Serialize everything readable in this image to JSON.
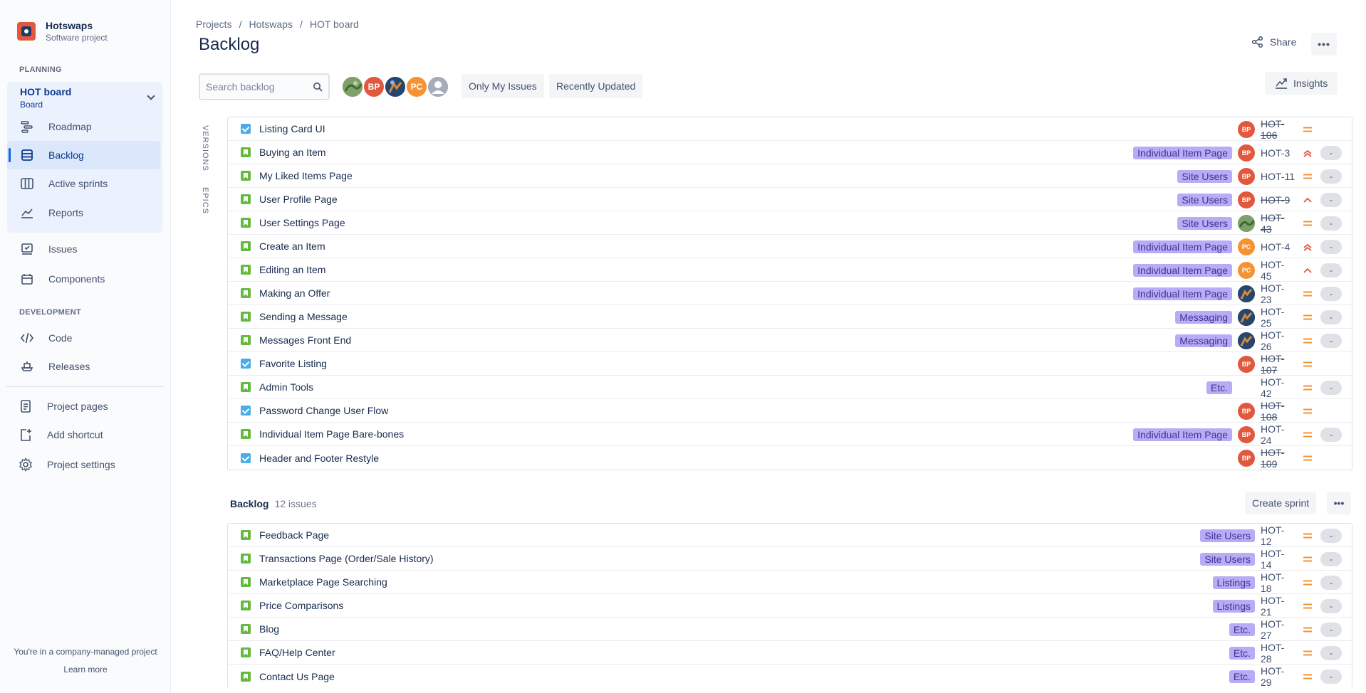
{
  "project": {
    "name": "Hotswaps",
    "type": "Software project"
  },
  "sidebar": {
    "planning_label": "PLANNING",
    "board": {
      "title": "HOT board",
      "subtitle": "Board"
    },
    "planning_items": [
      {
        "label": "Roadmap",
        "icon": "roadmap-icon"
      },
      {
        "label": "Backlog",
        "icon": "backlog-icon",
        "active": true
      },
      {
        "label": "Active sprints",
        "icon": "board-icon"
      },
      {
        "label": "Reports",
        "icon": "reports-icon"
      }
    ],
    "other_items": [
      {
        "label": "Issues",
        "icon": "issues-icon"
      },
      {
        "label": "Components",
        "icon": "components-icon"
      }
    ],
    "development_label": "DEVELOPMENT",
    "dev_items": [
      {
        "label": "Code",
        "icon": "code-icon"
      },
      {
        "label": "Releases",
        "icon": "releases-icon"
      }
    ],
    "bottom_items": [
      {
        "label": "Project pages",
        "icon": "pages-icon"
      },
      {
        "label": "Add shortcut",
        "icon": "add-shortcut-icon"
      },
      {
        "label": "Project settings",
        "icon": "gear-icon"
      }
    ],
    "footer_text": "You're in a company-managed project",
    "footer_link": "Learn more"
  },
  "breadcrumb": [
    "Projects",
    "Hotswaps",
    "HOT board"
  ],
  "title": "Backlog",
  "share_label": "Share",
  "insights_label": "Insights",
  "search": {
    "placeholder": "Search backlog"
  },
  "filters": [
    "Only My Issues",
    "Recently Updated"
  ],
  "avatars": [
    {
      "kind": "photo-nature",
      "color": "#6a8f5a"
    },
    {
      "initials": "BP",
      "color": "#e2583e"
    },
    {
      "kind": "photo-game",
      "color": "#2c4e7a"
    },
    {
      "initials": "PC",
      "color": "#f79232"
    },
    {
      "kind": "default",
      "color": "#a5adba"
    }
  ],
  "side_tabs": [
    "VERSIONS",
    "EPICS"
  ],
  "colors": {
    "accent": "#0c66e4",
    "story": "#63ba3c",
    "task": "#4bade8",
    "epic": "#b8acf6",
    "priority": "#f79232"
  },
  "sprint_issues": [
    {
      "type": "task",
      "summary": "Listing Card UI",
      "epic": "",
      "assignee": "BP",
      "key": "HOT-106",
      "done": true,
      "priority": "medium",
      "estimate": ""
    },
    {
      "type": "story",
      "summary": "Buying an Item",
      "epic": "Individual Item Page",
      "assignee": "BP",
      "key": "HOT-3",
      "done": false,
      "priority": "highest",
      "estimate": "-"
    },
    {
      "type": "story",
      "summary": "My Liked Items Page",
      "epic": "Site Users",
      "assignee": "BP",
      "key": "HOT-11",
      "done": false,
      "priority": "medium",
      "estimate": "-"
    },
    {
      "type": "story",
      "summary": "User Profile Page",
      "epic": "Site Users",
      "assignee": "BP",
      "key": "HOT-9",
      "done": true,
      "priority": "high",
      "estimate": "-"
    },
    {
      "type": "story",
      "summary": "User Settings Page",
      "epic": "Site Users",
      "assignee": "photo-nature",
      "key": "HOT-43",
      "done": true,
      "priority": "medium",
      "estimate": "-"
    },
    {
      "type": "story",
      "summary": "Create an Item",
      "epic": "Individual Item Page",
      "assignee": "PC",
      "key": "HOT-4",
      "done": false,
      "priority": "highest",
      "estimate": "-"
    },
    {
      "type": "story",
      "summary": "Editing an Item",
      "epic": "Individual Item Page",
      "assignee": "PC",
      "key": "HOT-45",
      "done": false,
      "priority": "high",
      "estimate": "-"
    },
    {
      "type": "story",
      "summary": "Making an Offer",
      "epic": "Individual Item Page",
      "assignee": "photo-game",
      "key": "HOT-23",
      "done": false,
      "priority": "medium",
      "estimate": "-"
    },
    {
      "type": "story",
      "summary": "Sending a Message",
      "epic": "Messaging",
      "assignee": "photo-game",
      "key": "HOT-25",
      "done": false,
      "priority": "medium",
      "estimate": "-"
    },
    {
      "type": "story",
      "summary": "Messages Front End",
      "epic": "Messaging",
      "assignee": "photo-game",
      "key": "HOT-26",
      "done": false,
      "priority": "medium",
      "estimate": "-"
    },
    {
      "type": "task",
      "summary": "Favorite Listing",
      "epic": "",
      "assignee": "BP",
      "key": "HOT-107",
      "done": true,
      "priority": "medium",
      "estimate": ""
    },
    {
      "type": "story",
      "summary": "Admin Tools",
      "epic": "Etc.",
      "assignee": "",
      "key": "HOT-42",
      "done": false,
      "priority": "medium",
      "estimate": "-"
    },
    {
      "type": "task",
      "summary": "Password Change User Flow",
      "epic": "",
      "assignee": "BP",
      "key": "HOT-108",
      "done": true,
      "priority": "medium",
      "estimate": ""
    },
    {
      "type": "story",
      "summary": "Individual Item Page Bare-bones",
      "epic": "Individual Item Page",
      "assignee": "BP",
      "key": "HOT-24",
      "done": false,
      "priority": "medium",
      "estimate": "-"
    },
    {
      "type": "task",
      "summary": "Header and Footer Restyle",
      "epic": "",
      "assignee": "BP",
      "key": "HOT-109",
      "done": true,
      "priority": "medium",
      "estimate": ""
    }
  ],
  "backlog": {
    "label": "Backlog",
    "count": "12 issues",
    "create_sprint_label": "Create sprint",
    "issues": [
      {
        "type": "story",
        "summary": "Feedback Page",
        "epic": "Site Users",
        "assignee": "",
        "key": "HOT-12",
        "done": false,
        "priority": "medium",
        "estimate": "-"
      },
      {
        "type": "story",
        "summary": "Transactions Page (Order/Sale History)",
        "epic": "Site Users",
        "assignee": "",
        "key": "HOT-14",
        "done": false,
        "priority": "medium",
        "estimate": "-"
      },
      {
        "type": "story",
        "summary": "Marketplace Page Searching",
        "epic": "Listings",
        "assignee": "",
        "key": "HOT-18",
        "done": false,
        "priority": "medium",
        "estimate": "-"
      },
      {
        "type": "story",
        "summary": "Price Comparisons",
        "epic": "Listings",
        "assignee": "",
        "key": "HOT-21",
        "done": false,
        "priority": "medium",
        "estimate": "-"
      },
      {
        "type": "story",
        "summary": "Blog",
        "epic": "Etc.",
        "assignee": "",
        "key": "HOT-27",
        "done": false,
        "priority": "medium",
        "estimate": "-"
      },
      {
        "type": "story",
        "summary": "FAQ/Help Center",
        "epic": "Etc.",
        "assignee": "",
        "key": "HOT-28",
        "done": false,
        "priority": "medium",
        "estimate": "-"
      },
      {
        "type": "story",
        "summary": "Contact Us Page",
        "epic": "Etc.",
        "assignee": "",
        "key": "HOT-29",
        "done": false,
        "priority": "medium",
        "estimate": "-"
      }
    ]
  }
}
